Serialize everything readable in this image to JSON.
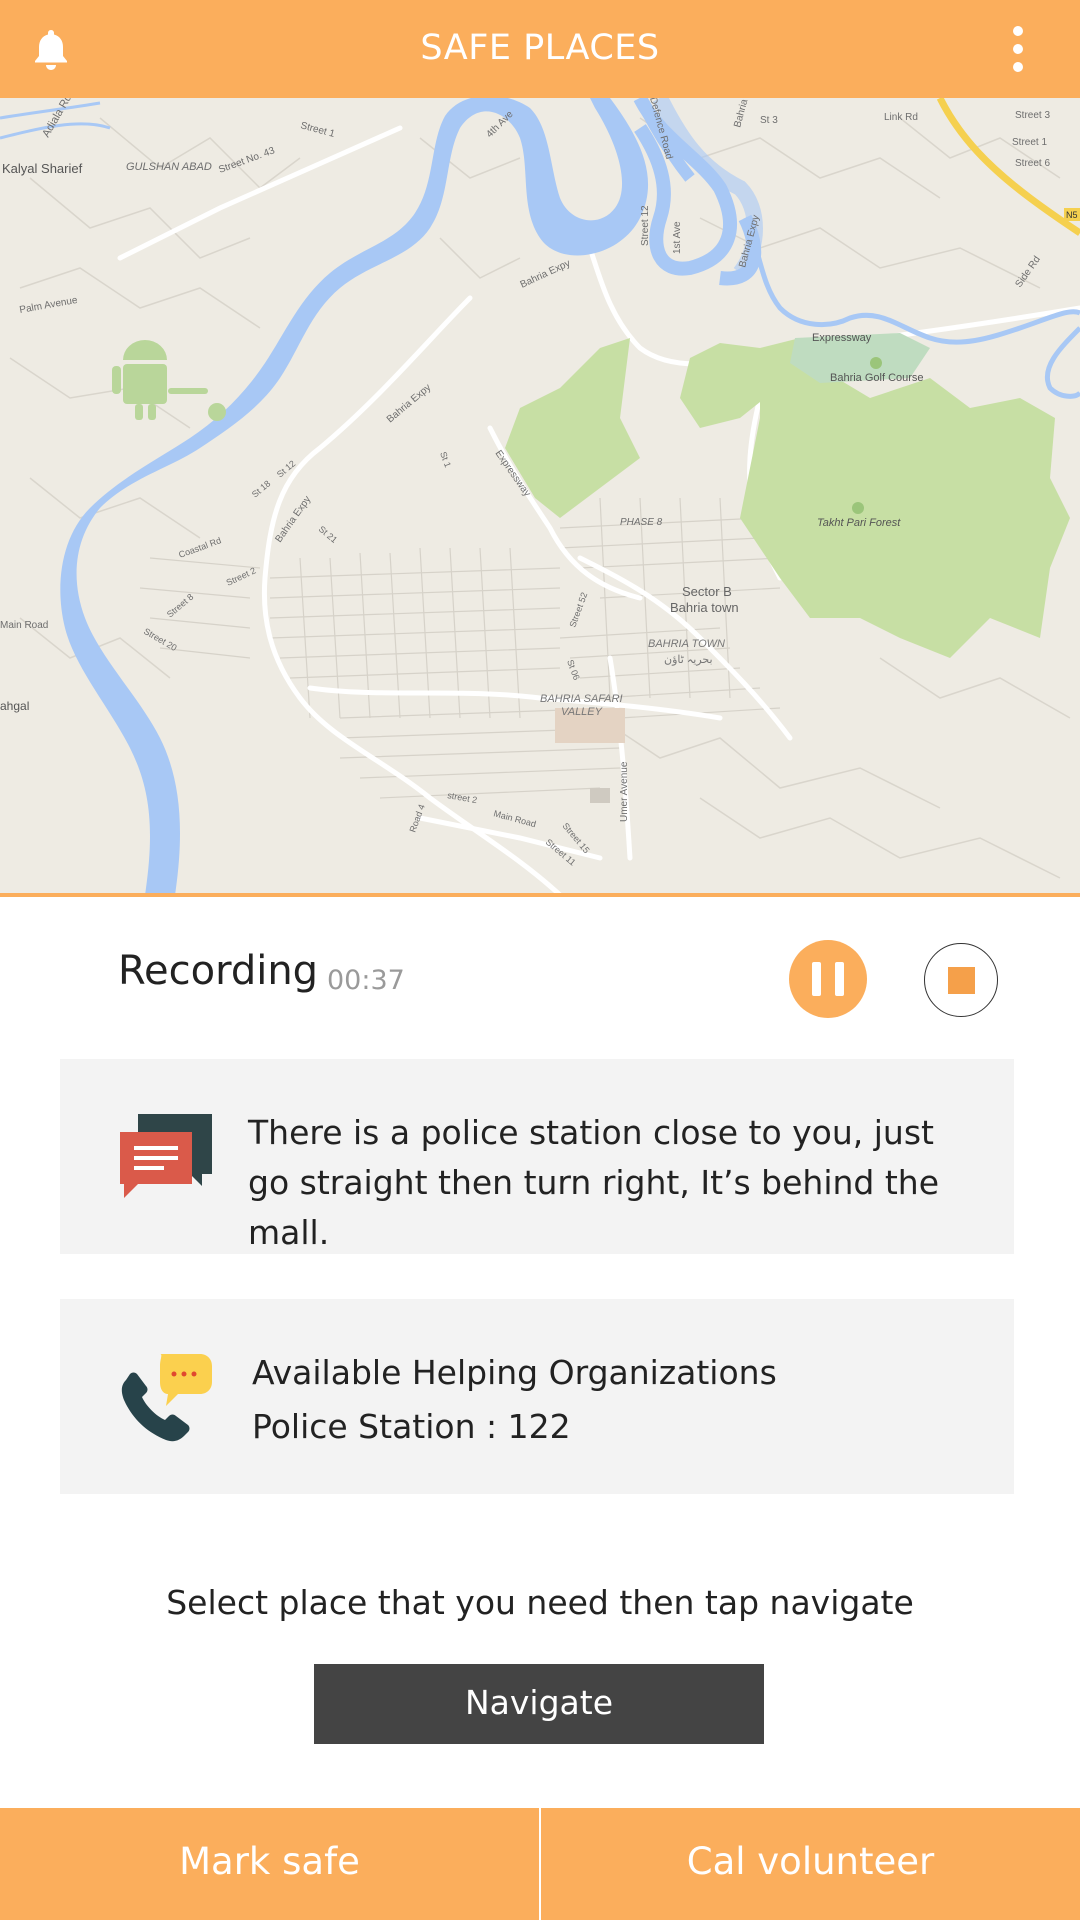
{
  "header": {
    "title": "SAFE PLACES",
    "bell_icon": "bell-icon",
    "menu_icon": "more-vertical-icon",
    "color": "#FBAE5C"
  },
  "map": {
    "labels": {
      "adiala_rd": "Adiala Rd",
      "kalyal_sharief": "Kalyal Sharief",
      "gulshan_abad": "GULSHAN ABAD",
      "street_no_43": "Street No. 43",
      "street_1": "Street 1",
      "fourth_ave": "4th Ave",
      "defence_road": "Defence Road",
      "bahria_expy": "Bahria Expy",
      "st3": "St 3",
      "link_rd": "Link Rd",
      "street_3": "Street 3",
      "street_1b": "Street 1",
      "street_6": "Street 6",
      "street_12": "Street 12",
      "first_ave": "1st Ave",
      "side_rd": "Side Rd",
      "palm_avenue": "Palm Avenue",
      "expressway": "Expressway",
      "bahria_golf_course": "Bahria Golf Course",
      "takht_pari_forest": "Takht Pari Forest",
      "phase_8": "PHASE 8",
      "st_1": "St 1",
      "coastal_rd": "Coastal Rd",
      "st18": "St 18",
      "st12": "St 12",
      "st21": "St 21",
      "street_2": "Street 2",
      "street_8": "Street 8",
      "street_20": "Street 20",
      "main_road": "Main Road",
      "ahgal": "ahgal",
      "sector_b": "Sector B",
      "bahria_town_line": "Bahria town",
      "bahria_town": "BAHRIA TOWN",
      "bahria_town_urdu": "بحریہ ٹاؤن",
      "street_52": "Street 52",
      "st_06": "St 06",
      "bahria_safari": "BAHRIA SAFARI",
      "valley": "VALLEY",
      "umer_avenue": "Umer Avenue",
      "street_2b": "street 2",
      "main_road_2": "Main Road",
      "street_15": "Street 15",
      "street_11": "Street 11",
      "road_4": "Road 4",
      "n5": "N5"
    }
  },
  "recording": {
    "label": "Recording",
    "time": "00:37",
    "pause_icon": "pause-icon",
    "stop_icon": "stop-icon"
  },
  "message_card": {
    "icon": "chat-bubbles-icon",
    "text": "There is a police station close to you, just go straight then turn right, It’s behind the mall."
  },
  "organizations_card": {
    "icon": "phone-chat-icon",
    "title": "Available Helping Organizations",
    "detail": "Police Station : 122"
  },
  "instruction": "Select place that you need then tap navigate",
  "navigate_button": "Navigate",
  "bottom_bar": {
    "mark_safe": "Mark safe",
    "call_volunteer": "Cal volunteer"
  }
}
